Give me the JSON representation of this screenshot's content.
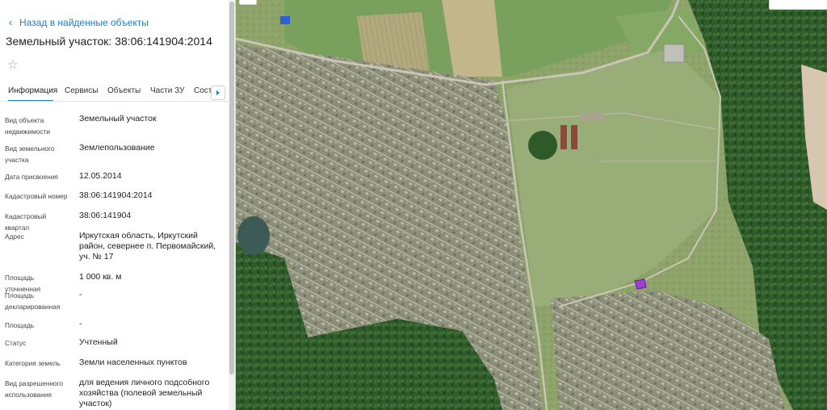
{
  "panel": {
    "back_link": "Назад в найденные объекты",
    "title": "Земельный участок: 38:06:141904:2014",
    "tabs": [
      "Информация",
      "Сервисы",
      "Объекты",
      "Части ЗУ",
      "Соста"
    ],
    "active_tab": 0,
    "properties": [
      {
        "label": "Вид объекта недвижимости",
        "value": "Земельный участок"
      },
      {
        "label": "Вид земельного участка",
        "value": "Землепользование"
      },
      {
        "label": "Дата присвоения",
        "value": "12.05.2014"
      },
      {
        "label": "Кадастровый номер",
        "value": "38:06:141904:2014"
      },
      {
        "label": "Кадастровый квартал",
        "value": "38:06:141904"
      },
      {
        "label": "Адрес",
        "value": "Иркутская область, Иркутский район, севернее п. Первомайский, уч. № 17"
      },
      {
        "label": "Площадь уточненная",
        "value": "1 000 кв. м"
      },
      {
        "label": "Площадь декларированная",
        "value": "-"
      },
      {
        "label": "Площадь",
        "value": "-"
      },
      {
        "label": "Статус",
        "value": "Учтенный"
      },
      {
        "label": "Категория земель",
        "value": "Земли населенных пунктов"
      },
      {
        "label": "Вид разрешенного использования",
        "value": "для ведения личного подсобного хозяйства (полевой земельный участок)"
      }
    ]
  },
  "icons": {
    "back": "chevron-left-icon",
    "favorite": "star-outline-icon",
    "tabs_next": "triangle-right-icon"
  },
  "colors": {
    "accent": "#1f7fc4",
    "parcel_highlight": "#9b3fd6"
  }
}
